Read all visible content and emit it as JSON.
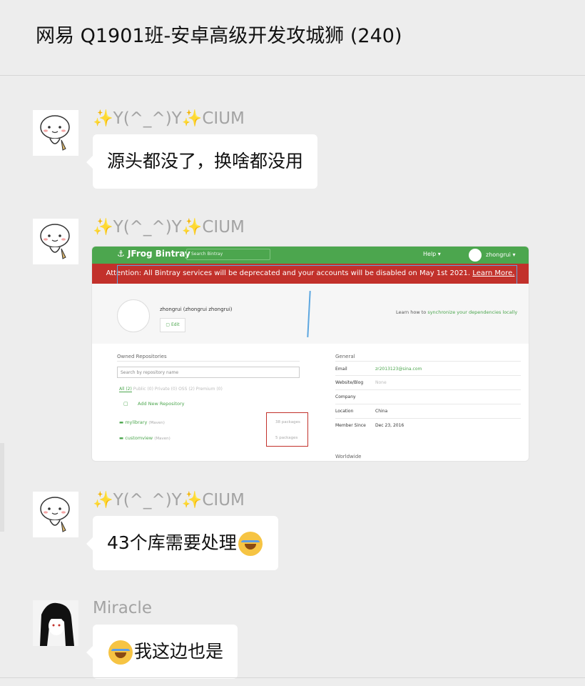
{
  "chat": {
    "title": "网易 Q1901班-安卓高级开发攻城狮 (240)"
  },
  "messages": [
    {
      "sender_sparkle_left": "✨",
      "sender_core": "Y(^_^)Y",
      "sender_sparkle_right": "✨",
      "sender_tail": "CIUM",
      "text": "源头都没了，换啥都没用"
    },
    {
      "sender_sparkle_left": "✨",
      "sender_core": "Y(^_^)Y",
      "sender_sparkle_right": "✨",
      "sender_tail": "CIUM",
      "image": {
        "logo": "JFrog Bintray",
        "search_placeholder": "Search Bintray",
        "help": "Help ▾",
        "username": "zhongrui ▾",
        "banner_text": "Attention: All Bintray services will be deprecated and your accounts will be disabled on May 1st 2021.",
        "banner_link": "Learn More.",
        "profile_name": "zhongrui  (zhongrui zhongrui)",
        "edit": "Edit",
        "learn_prefix": "Learn how to ",
        "learn_link": "synchronize your dependencies locally",
        "owned_title": "Owned Repositories",
        "repo_search_placeholder": "Search by repository name",
        "tabs_active": "All (2)",
        "tabs_rest": "Public (0)    Private (0)    OSS (2)    Premium (0)",
        "add_new": "Add New Repository",
        "repos": [
          {
            "name": "mylibrary",
            "type": "(Maven)",
            "packages": "38 packages"
          },
          {
            "name": "customview",
            "type": "(Maven)",
            "packages": "5 packages"
          }
        ],
        "general_title": "General",
        "general": [
          {
            "label": "Email",
            "value": "zr2013123@sina.com"
          },
          {
            "label": "Website/Blog",
            "value": "None"
          },
          {
            "label": "Company",
            "value": ""
          },
          {
            "label": "Location",
            "value": "China"
          },
          {
            "label": "Member Since",
            "value": "Dec 23, 2016"
          }
        ],
        "worldwide": "Worldwide"
      }
    },
    {
      "sender_sparkle_left": "✨",
      "sender_core": "Y(^_^)Y",
      "sender_sparkle_right": "✨",
      "sender_tail": "CIUM",
      "text": "43个库需要处理",
      "emoji_name": "crying-laughing-emoji"
    },
    {
      "sender": "Miracle",
      "text": "我这边也是",
      "emoji_name": "crying-laughing-emoji"
    }
  ],
  "colors": {
    "background": "#ededed",
    "bintray_green": "#4ca64e",
    "banner_red": "#c2312b",
    "callout_blue": "#5da7e0"
  }
}
